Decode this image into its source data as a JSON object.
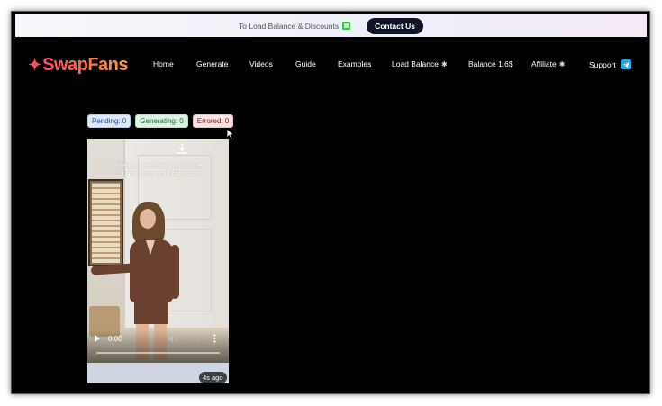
{
  "topbar": {
    "promo_text": "To Load Balance & Discounts",
    "contact_label": "Contact Us"
  },
  "logo": {
    "text": "SwapFans"
  },
  "nav": {
    "home": "Home",
    "generate": "Generate",
    "videos": "Videos",
    "guide": "Guide",
    "examples": "Examples",
    "load_balance": "Load Balance",
    "balance": "Balance 1.6$",
    "affiliate": "Affiliate",
    "support": "Support"
  },
  "status": {
    "pending": "Pending: 0",
    "generating": "Generating: 0",
    "errored": "Errored: 0"
  },
  "video": {
    "caption": "When someone tells you for the 1st time you're your bat squad",
    "time": "0:00",
    "age": "4s ago"
  },
  "colors": {
    "background": "#000000",
    "logo_gradient_start": "#ff4d6d",
    "logo_gradient_end": "#ff9a3c",
    "contact_button": "#0e1527",
    "telegram": "#2aa3df"
  },
  "icons": {
    "promo": "green-square-icon",
    "load_balance": "bug-icon",
    "affiliate": "bug-icon",
    "support": "telegram-icon",
    "download": "download-icon",
    "play": "play-icon",
    "volume": "volume-icon",
    "fullscreen": "fullscreen-icon",
    "more": "more-vertical-icon"
  }
}
